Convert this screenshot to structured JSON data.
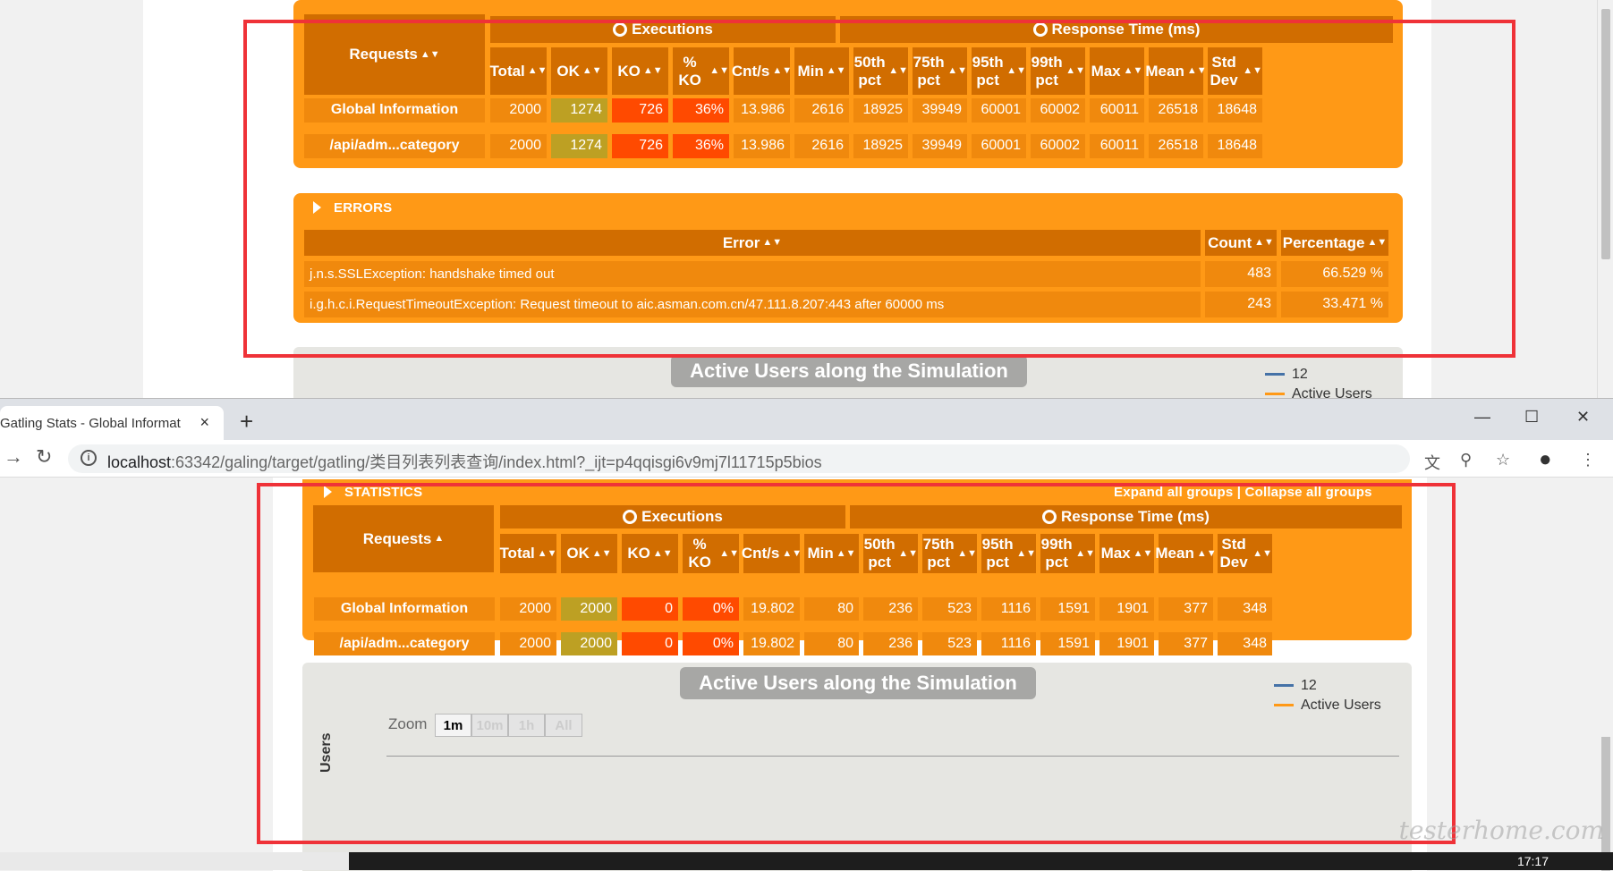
{
  "top_window": {
    "executions_header": "Executions",
    "response_header": "Response Time (ms)",
    "requests_header": "Requests",
    "columns": [
      "Total",
      "OK",
      "KO",
      "% KO",
      "Cnt/s",
      "Min",
      "50th pct",
      "75th pct",
      "95th pct",
      "99th pct",
      "Max",
      "Mean",
      "Std Dev"
    ],
    "rows": [
      {
        "label": "Global Information",
        "values": [
          "2000",
          "1274",
          "726",
          "36%",
          "13.986",
          "2616",
          "18925",
          "39949",
          "60001",
          "60002",
          "60011",
          "26518",
          "18648"
        ]
      },
      {
        "label": "/api/adm...category",
        "values": [
          "2000",
          "1274",
          "726",
          "36%",
          "13.986",
          "2616",
          "18925",
          "39949",
          "60001",
          "60002",
          "60011",
          "26518",
          "18648"
        ]
      }
    ],
    "errors_title": "ERRORS",
    "errors_headers": [
      "Error",
      "Count",
      "Percentage"
    ],
    "errors": [
      {
        "error": "j.n.s.SSLException: handshake timed out",
        "count": "483",
        "pct": "66.529 %"
      },
      {
        "error": "i.g.h.c.i.RequestTimeoutException: Request timeout to aic.asman.com.cn/47.111.8.207:443 after 60000 ms",
        "count": "243",
        "pct": "33.471 %"
      }
    ],
    "chart_title": "Active Users along the Simulation",
    "legend_count": "12",
    "legend_label": "Active Users"
  },
  "browser": {
    "tab_title": "Gatling Stats - Global Informat",
    "tab_close": "×",
    "new_tab": "+",
    "url_host": "localhost",
    "url_rest": ":63342/galing/target/gatling/类目列表列表查询/index.html?_ijt=p4qqisgi6v9mj7l11715p5bios",
    "win_min": "—",
    "win_max": "☐",
    "win_close": "✕"
  },
  "bottom_page": {
    "statistics_title": "STATISTICS",
    "expand_collapse": "Expand all groups | Collapse all groups",
    "executions_header": "Executions",
    "response_header": "Response Time (ms)",
    "requests_header": "Requests",
    "columns": [
      "Total",
      "OK",
      "KO",
      "% KO",
      "Cnt/s",
      "Min",
      "50th pct",
      "75th pct",
      "95th pct",
      "99th pct",
      "Max",
      "Mean",
      "Std Dev"
    ],
    "rows": [
      {
        "label": "Global Information",
        "values": [
          "2000",
          "2000",
          "0",
          "0%",
          "19.802",
          "80",
          "236",
          "523",
          "1116",
          "1591",
          "1901",
          "377",
          "348"
        ]
      },
      {
        "label": "/api/adm...category",
        "values": [
          "2000",
          "2000",
          "0",
          "0%",
          "19.802",
          "80",
          "236",
          "523",
          "1116",
          "1591",
          "1901",
          "377",
          "348"
        ]
      }
    ],
    "chart_title": "Active Users along the Simulation",
    "zoom_label": "Zoom",
    "zoom_buttons": [
      "1m",
      "10m",
      "1h",
      "All"
    ],
    "legend_count": "12",
    "legend_label": "Active Users",
    "y_axis_label": "Users"
  },
  "taskbar": {
    "clock": "17:17"
  },
  "watermark": "testerhome.com",
  "colors": {
    "orange": "#ff9916",
    "dark_orange": "#d16d00",
    "ok": "#bda023",
    "ko": "#ff4a00",
    "highlight_red": "#ef3238"
  }
}
